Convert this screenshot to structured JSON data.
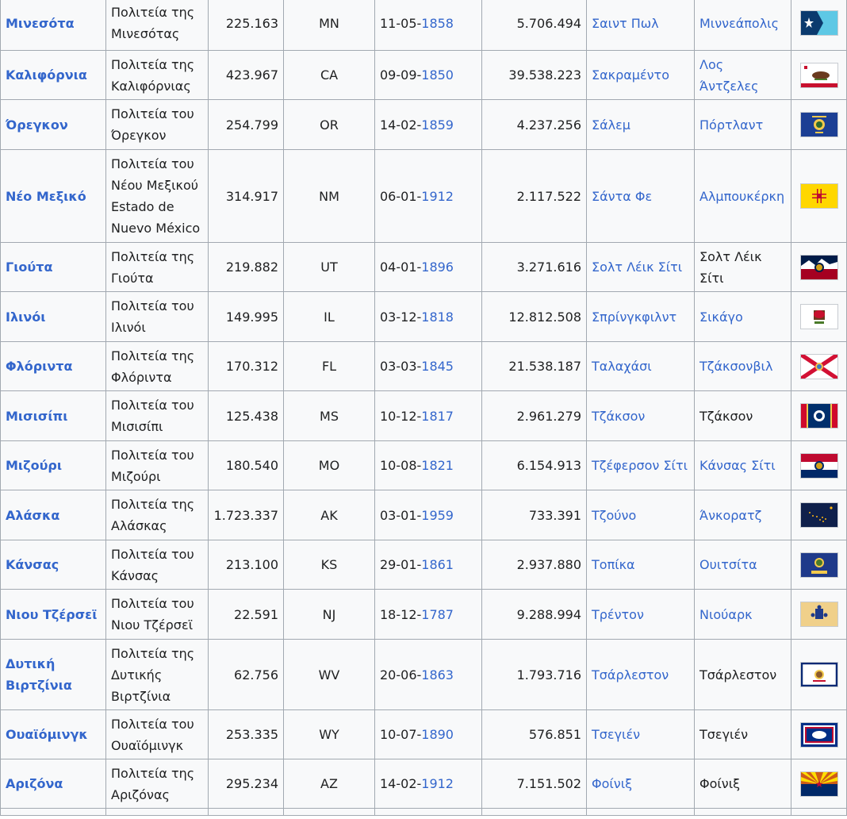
{
  "rows": [
    {
      "name": "Μινεσότα",
      "official": [
        "Πολιτεία της",
        "Μινεσότας"
      ],
      "area": "225.163",
      "abbr": "MN",
      "date_prefix": "11-05-",
      "year": "1858",
      "population": "5.706.494",
      "capital": "Σαιντ Πωλ",
      "capital_link": true,
      "largest": "Μιννεάπολις",
      "largest_link": true,
      "flag": "minnesota-flag-icon"
    },
    {
      "name": "Καλιφόρνια",
      "official": [
        "Πολιτεία της",
        "Καλιφόρνιας"
      ],
      "area": "423.967",
      "abbr": "CA",
      "date_prefix": "09-09-",
      "year": "1850",
      "population": "39.538.223",
      "capital": "Σακραμέντο",
      "capital_link": true,
      "largest": "Λος Άντζελες",
      "largest_link": true,
      "flag": "california-flag-icon"
    },
    {
      "name": "Όρεγκον",
      "official": [
        "Πολιτεία του",
        "Όρεγκον"
      ],
      "area": "254.799",
      "abbr": "OR",
      "date_prefix": "14-02-",
      "year": "1859",
      "population": "4.237.256",
      "capital": "Σάλεμ",
      "capital_link": true,
      "largest": "Πόρτλαντ",
      "largest_link": true,
      "flag": "oregon-flag-icon"
    },
    {
      "name": "Νέο Μεξικό",
      "official": [
        "Πολιτεία του",
        "Νέου Μεξικού",
        "Estado de",
        "Nuevo México"
      ],
      "area": "314.917",
      "abbr": "NM",
      "date_prefix": "06-01-",
      "year": "1912",
      "population": "2.117.522",
      "capital": "Σάντα Φε",
      "capital_link": true,
      "largest": "Αλμπουκέρκη",
      "largest_link": true,
      "flag": "new-mexico-flag-icon"
    },
    {
      "name": "Γιούτα",
      "official": [
        "Πολιτεία της",
        "Γιούτα"
      ],
      "area": "219.882",
      "abbr": "UT",
      "date_prefix": "04-01-",
      "year": "1896",
      "population": "3.271.616",
      "capital": "Σολτ Λέικ Σίτι",
      "capital_link": true,
      "largest": "Σολτ Λέικ Σίτι",
      "largest_link": false,
      "flag": "utah-flag-icon"
    },
    {
      "name": "Ιλινόι",
      "official": [
        "Πολιτεία του",
        "Ιλινόι"
      ],
      "area": "149.995",
      "abbr": "IL",
      "date_prefix": "03-12-",
      "year": "1818",
      "population": "12.812.508",
      "capital": "Σπρίνγκφιλντ",
      "capital_link": true,
      "largest": "Σικάγο",
      "largest_link": true,
      "flag": "illinois-flag-icon"
    },
    {
      "name": "Φλόριντα",
      "official": [
        "Πολιτεία της",
        "Φλόριντα"
      ],
      "area": "170.312",
      "abbr": "FL",
      "date_prefix": "03-03-",
      "year": "1845",
      "population": "21.538.187",
      "capital": "Ταλαχάσι",
      "capital_link": true,
      "largest": "Τζάκσονβιλ",
      "largest_link": true,
      "flag": "florida-flag-icon"
    },
    {
      "name": "Μισισίπι",
      "official": [
        "Πολιτεία του",
        "Μισισίπι"
      ],
      "area": "125.438",
      "abbr": "MS",
      "date_prefix": "10-12-",
      "year": "1817",
      "population": "2.961.279",
      "capital": "Τζάκσον",
      "capital_link": true,
      "largest": "Τζάκσον",
      "largest_link": false,
      "flag": "mississippi-flag-icon"
    },
    {
      "name": "Μιζούρι",
      "official": [
        "Πολιτεία του",
        "Μιζούρι"
      ],
      "area": "180.540",
      "abbr": "MO",
      "date_prefix": "10-08-",
      "year": "1821",
      "population": "6.154.913",
      "capital": "Τζέφερσον Σίτι",
      "capital_link": true,
      "largest": "Κάνσας Σίτι",
      "largest_link": true,
      "flag": "missouri-flag-icon"
    },
    {
      "name": "Αλάσκα",
      "official": [
        "Πολιτεία της",
        "Αλάσκας"
      ],
      "area": "1.723.337",
      "abbr": "AK",
      "date_prefix": "03-01-",
      "year": "1959",
      "population": "733.391",
      "capital": "Τζούνο",
      "capital_link": true,
      "largest": "Άνκορατζ",
      "largest_link": true,
      "flag": "alaska-flag-icon"
    },
    {
      "name": "Κάνσας",
      "official": [
        "Πολιτεία του",
        "Κάνσας"
      ],
      "area": "213.100",
      "abbr": "KS",
      "date_prefix": "29-01-",
      "year": "1861",
      "population": "2.937.880",
      "capital": "Τοπίκα",
      "capital_link": true,
      "largest": "Ουιτσίτα",
      "largest_link": true,
      "flag": "kansas-flag-icon"
    },
    {
      "name": "Νιου Τζέρσεϊ",
      "official": [
        "Πολιτεία του",
        "Νιου Τζέρσεϊ"
      ],
      "area": "22.591",
      "abbr": "NJ",
      "date_prefix": "18-12-",
      "year": "1787",
      "population": "9.288.994",
      "capital": "Τρέντον",
      "capital_link": true,
      "largest": "Νιούαρκ",
      "largest_link": true,
      "flag": "new-jersey-flag-icon"
    },
    {
      "name": "Δυτική Βιρτζίνια",
      "official": [
        "Πολιτεία της",
        "Δυτικής",
        "Βιρτζίνια"
      ],
      "area": "62.756",
      "abbr": "WV",
      "date_prefix": "20-06-",
      "year": "1863",
      "population": "1.793.716",
      "capital": "Τσάρλεστον",
      "capital_link": true,
      "largest": "Τσάρλεστον",
      "largest_link": false,
      "flag": "west-virginia-flag-icon"
    },
    {
      "name": "Ουαϊόμινγκ",
      "official": [
        "Πολιτεία του",
        "Ουαϊόμινγκ"
      ],
      "area": "253.335",
      "abbr": "WY",
      "date_prefix": "10-07-",
      "year": "1890",
      "population": "576.851",
      "capital": "Τσεγιέν",
      "capital_link": true,
      "largest": "Τσεγιέν",
      "largest_link": false,
      "flag": "wyoming-flag-icon"
    },
    {
      "name": "Αριζόνα",
      "official": [
        "Πολιτεία της",
        "Αριζόνας"
      ],
      "area": "295.234",
      "abbr": "AZ",
      "date_prefix": "14-02-",
      "year": "1912",
      "population": "7.151.502",
      "capital": "Φοίνιξ",
      "capital_link": true,
      "largest": "Φοίνιξ",
      "largest_link": false,
      "flag": "arizona-flag-icon"
    }
  ],
  "colors": {
    "link": "#3366cc",
    "text": "#202122",
    "border": "#a2a9b1",
    "cell_bg": "#f8f9fa"
  }
}
